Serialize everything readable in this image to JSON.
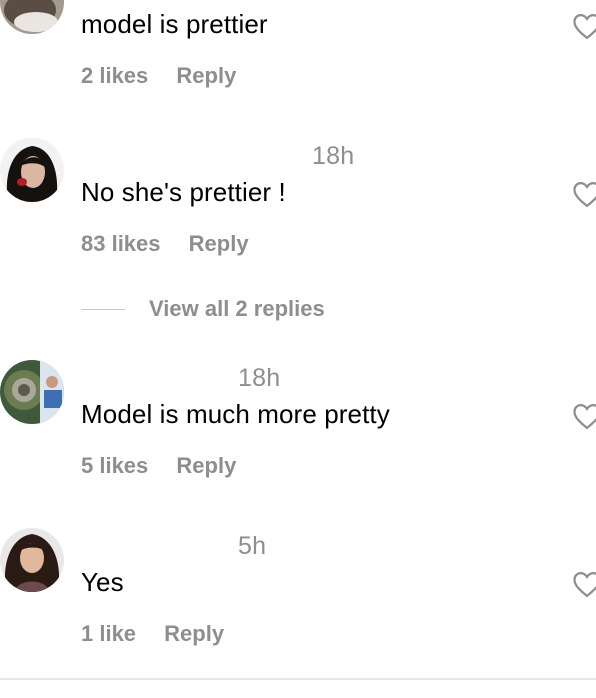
{
  "comments": [
    {
      "time": "",
      "text": "model is prettier",
      "likes": "2 likes",
      "reply": "Reply"
    },
    {
      "time": "18h",
      "text": "No she's prettier !",
      "likes": "83 likes",
      "reply": "Reply",
      "view_replies": "View all 2 replies"
    },
    {
      "time": "18h",
      "text": "Model is much more pretty",
      "likes": "5 likes",
      "reply": "Reply"
    },
    {
      "time": "5h",
      "text": "Yes",
      "likes": "1 like",
      "reply": "Reply"
    }
  ],
  "icons": {
    "like": "heart-outline-icon"
  },
  "colors": {
    "muted": "#8e8e8e",
    "divider": "#c7c7c7"
  }
}
